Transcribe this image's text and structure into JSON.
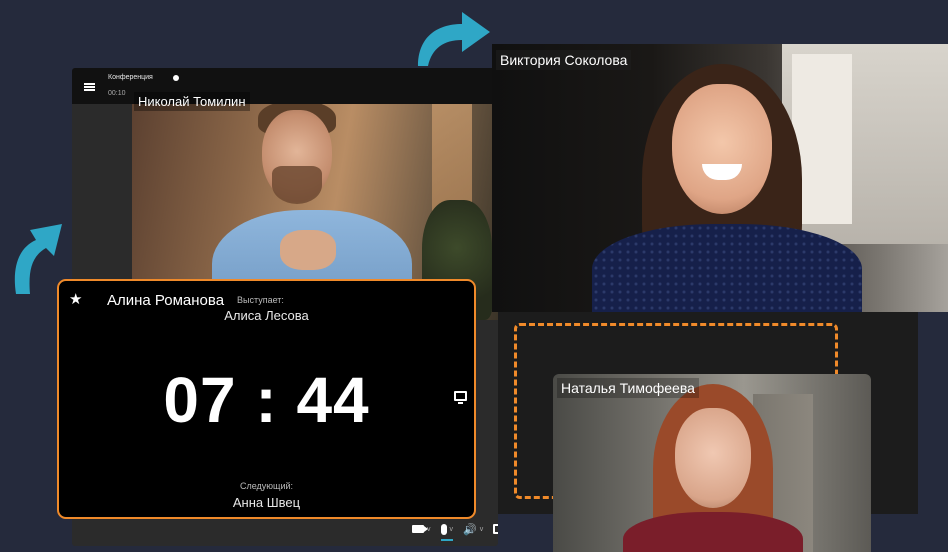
{
  "colors": {
    "background": "#252a3c",
    "accent_orange": "#f08a2a",
    "arrow_teal": "#2fa7c6"
  },
  "conference": {
    "title": "Конференция",
    "time": "00:10",
    "participant_main": "Николай Томилин"
  },
  "participants": {
    "victoria": "Виктория Соколова",
    "natalia": "Наталья Тимофеева"
  },
  "timer": {
    "owner": "Алина Романова",
    "speaking_label": "Выступает:",
    "speaking_name": "Алиса Лесова",
    "value": "07 : 44",
    "next_label": "Следующий:",
    "next_name": "Анна Швец"
  },
  "toolbar": {
    "icons": [
      "camera-icon",
      "microphone-icon",
      "speaker-icon",
      "screen-share-icon",
      "more-icon"
    ],
    "more": "···"
  }
}
